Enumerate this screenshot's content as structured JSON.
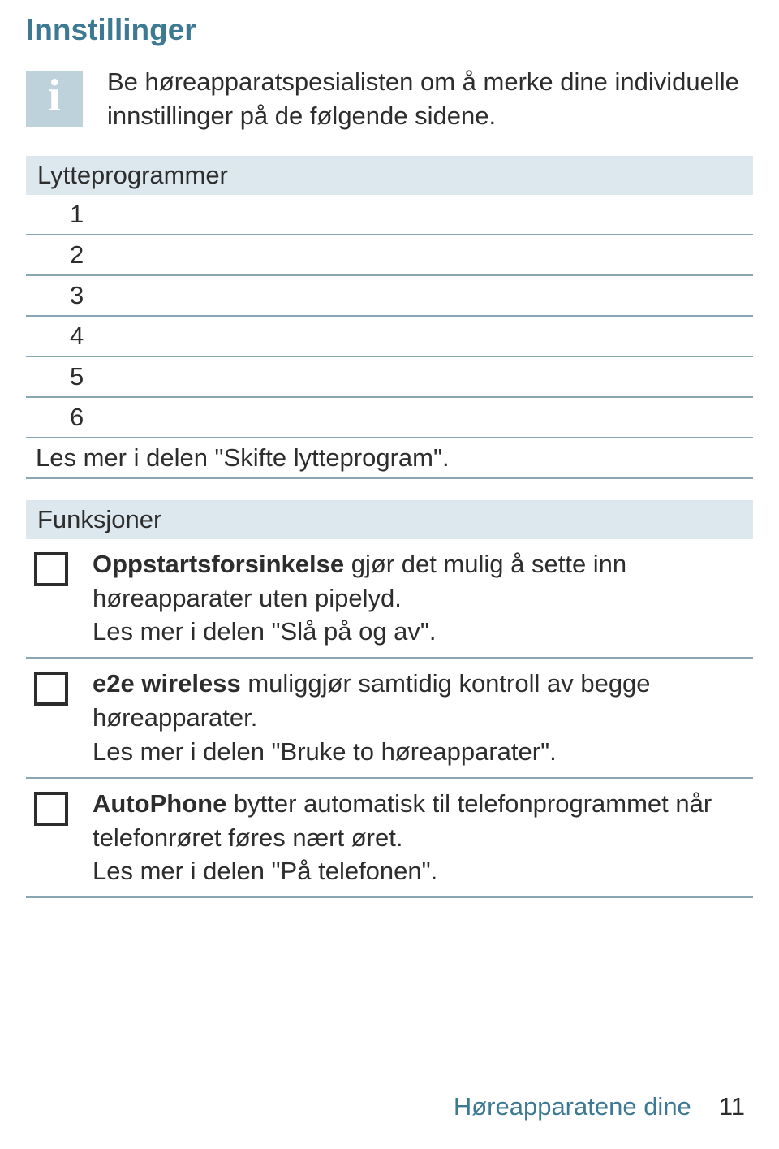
{
  "title": "Innstillinger",
  "info_glyph": "i",
  "intro": "Be høreapparatspesialisten om å merke dine individuelle innstillinger på de følgende sidene.",
  "sections": {
    "lytteprogrammer": {
      "header": "Lytteprogrammer",
      "rows": [
        "1",
        "2",
        "3",
        "4",
        "5",
        "6"
      ],
      "note": "Les mer i delen \"Skifte lytteprogram\"."
    },
    "funksjoner": {
      "header": "Funksjoner",
      "items": [
        {
          "bold": "Oppstartsforsinkelse",
          "rest": " gjør det mulig å sette inn høreapparater uten pipelyd.",
          "more": "Les mer i delen \"Slå på og av\"."
        },
        {
          "bold": "e2e wireless",
          "rest": " muliggjør samtidig kontroll av begge høreapparater.",
          "more": "Les mer i delen \"Bruke to høreapparater\"."
        },
        {
          "bold": "AutoPhone",
          "rest": " bytter automatisk til telefonprogrammet når telefonrøret føres nært øret.",
          "more": "Les mer i delen \"På telefonen\"."
        }
      ]
    }
  },
  "footer": {
    "label": "Høreapparatene dine",
    "page": "11"
  }
}
